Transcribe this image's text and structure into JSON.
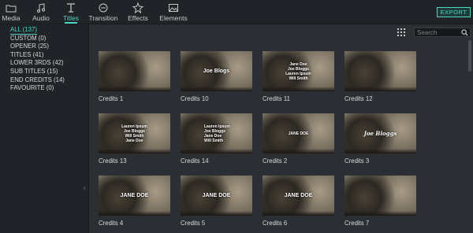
{
  "tabs": [
    {
      "label": "Media",
      "icon": "folder-icon",
      "active": false
    },
    {
      "label": "Audio",
      "icon": "music-note-icon",
      "active": false
    },
    {
      "label": "Titles",
      "icon": "text-icon",
      "active": true
    },
    {
      "label": "Transition",
      "icon": "transition-icon",
      "active": false
    },
    {
      "label": "Effects",
      "icon": "effects-icon",
      "active": false
    },
    {
      "label": "Elements",
      "icon": "image-icon",
      "active": false
    }
  ],
  "export_label": "EXPORT",
  "categories": [
    {
      "label": "ALL (137)",
      "active": true
    },
    {
      "label": "CUSTOM (0)",
      "active": false
    },
    {
      "label": "OPENER (25)",
      "active": false
    },
    {
      "label": "TITLES (41)",
      "active": false
    },
    {
      "label": "LOWER 3RDS (42)",
      "active": false
    },
    {
      "label": "SUB TITLES (15)",
      "active": false
    },
    {
      "label": "END CREDITS (14)",
      "active": false
    },
    {
      "label": "FAVOURITE (0)",
      "active": false
    }
  ],
  "search": {
    "placeholder": "Search"
  },
  "collapse_glyph": "‹",
  "items": [
    {
      "label": "Credits 1",
      "overlay": [],
      "style": ""
    },
    {
      "label": "Credits 10",
      "overlay": [
        "Joe Blogs"
      ],
      "style": "big"
    },
    {
      "label": "Credits 11",
      "overlay": [
        "Jane Doe",
        "Joe Bloggs",
        "Lauren Ipsum",
        "Will Smith"
      ],
      "style": ""
    },
    {
      "label": "Credits 12",
      "overlay": [],
      "style": ""
    },
    {
      "label": "Credits 13",
      "overlay": [
        "Lauren Ipsum",
        "Joe Bloggs",
        "Will Smith",
        "Jane Doe"
      ],
      "style": ""
    },
    {
      "label": "Credits 14",
      "overlay": [
        "Lauren Ipsum",
        "Joe Bloggs",
        "Jane Doe",
        "Will Smith"
      ],
      "style": "side"
    },
    {
      "label": "Credits 2",
      "overlay": [
        "JANE DOE"
      ],
      "style": ""
    },
    {
      "label": "Credits 3",
      "overlay": [
        "Joe Bloggs"
      ],
      "style": "script"
    },
    {
      "label": "Credits 4",
      "overlay": [
        "JANE DOE"
      ],
      "style": "big"
    },
    {
      "label": "Credits 5",
      "overlay": [
        "JANE DOE"
      ],
      "style": "big"
    },
    {
      "label": "Credits 6",
      "overlay": [
        "JANE DOE"
      ],
      "style": "big"
    },
    {
      "label": "Credits 7",
      "overlay": [],
      "style": "small"
    }
  ]
}
